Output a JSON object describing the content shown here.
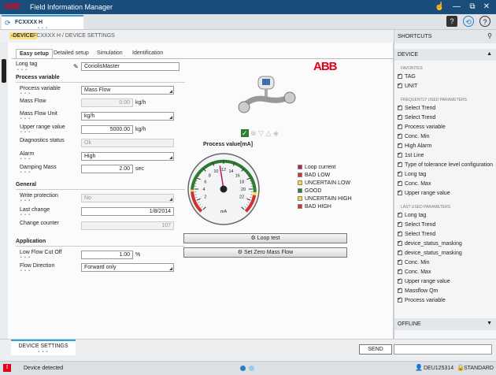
{
  "app": {
    "brand": "ABB",
    "title": "Field Information Manager"
  },
  "device_tab": {
    "label": "FCXXXX H"
  },
  "breadcrumb": {
    "device": "-DEVICE-",
    "path": "FCXXXX H / DEVICE SETTINGS"
  },
  "tabs": [
    "Easy setup",
    "Detailed setup",
    "Simulation",
    "Identification"
  ],
  "long_tag": {
    "label": "Long tag",
    "value": "CoriolisMaster"
  },
  "process_variable": {
    "title": "Process variable",
    "fields": {
      "process_variable": {
        "label": "Process variable",
        "value": "Mass Flow"
      },
      "mass_flow": {
        "label": "Mass Flow",
        "value": "0.00",
        "unit": "kg/h"
      },
      "mass_flow_unit": {
        "label": "Mass Flow Unit",
        "value": "kg/h"
      },
      "upper_range": {
        "label": "Upper range value",
        "value": "5000.00",
        "unit": "kg/h"
      },
      "diag_status": {
        "label": "Diagnostics status",
        "value": "Ok"
      },
      "alarm": {
        "label": "Alarm",
        "value": "High"
      },
      "damping": {
        "label": "Damping Mass",
        "value": "2.00",
        "unit": "sec"
      }
    }
  },
  "general": {
    "title": "General",
    "write_protection": {
      "label": "Write protection",
      "value": "No"
    },
    "last_change": {
      "label": "Last change",
      "value": "1/8/2014"
    },
    "change_counter": {
      "label": "Change counter",
      "value": "107"
    }
  },
  "application": {
    "title": "Application",
    "low_flow": {
      "label": "Low Flow Cut Off",
      "value": "1.00",
      "unit": "%"
    },
    "flow_direction": {
      "label": "Flow Direction",
      "value": "Forward only"
    }
  },
  "gauge": {
    "title": "Process value[mA]",
    "ticks": [
      "2",
      "4",
      "6",
      "8",
      "10",
      "12",
      "14",
      "16",
      "18",
      "20",
      "22"
    ],
    "unit": "mA",
    "value": 11.2
  },
  "legend": [
    {
      "label": "Loop current",
      "color": "#c2185b"
    },
    {
      "label": "BAD LOW",
      "color": "#d32f2f"
    },
    {
      "label": "UNCERTAIN LOW",
      "color": "#fdd835"
    },
    {
      "label": "GOOD",
      "color": "#2e7d32"
    },
    {
      "label": "UNCERTAIN HIGH",
      "color": "#fdd835"
    },
    {
      "label": "BAD HIGH",
      "color": "#d32f2f"
    }
  ],
  "buttons": {
    "loop_test": "Loop test",
    "zero": "Set Zero Mass Flow",
    "send": "SEND"
  },
  "shortcuts": {
    "title": "SHORTCUTS",
    "device": "DEVICE",
    "offline": "OFFLINE",
    "groups": {
      "favorites": "FAVORITES",
      "frequent": "FREQUENTLY USED PARAMETERS",
      "last": "LAST USED PARAMETERS"
    },
    "favorites": [
      "TAG",
      "UNIT"
    ],
    "frequent": [
      "Select Trend",
      "Select Trend",
      "Process variable",
      "Conc. Min",
      "High Alarm",
      "1st Line",
      "Type of tolerance level configuration",
      "Long tag",
      "Conc. Max",
      "Upper range value"
    ],
    "last": [
      "Long tag",
      "Select Trend",
      "Select Trend",
      "device_status_masking",
      "device_status_masking",
      "Conc. Min",
      "Conc. Max",
      "Upper range value",
      "Massflow Qm",
      "Process variable"
    ]
  },
  "bottom": {
    "tab": "DEVICE SETTINGS"
  },
  "status": {
    "text": "Device detected",
    "user": "DEU125314",
    "mode": "STANDARD"
  },
  "colors": {
    "topbar": "#1a4d7a",
    "accent": "#2aa4e3",
    "abb_red": "#e2001a"
  }
}
